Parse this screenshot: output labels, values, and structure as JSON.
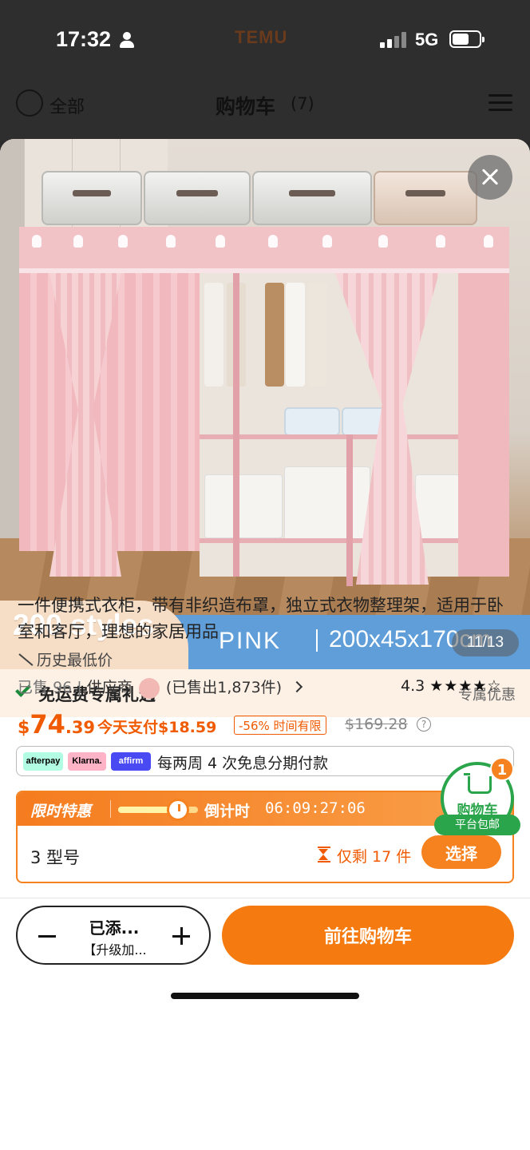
{
  "status_bar": {
    "time": "17:32",
    "brand": "TEMU",
    "network": "5G"
  },
  "cart_header": {
    "select_all": "全部",
    "title": "购物车",
    "count": "(7)"
  },
  "product": {
    "image_banner_styles": "200 styles",
    "image_banner_color": "PINK",
    "image_banner_size": "200x45x170cm",
    "image_counter": "11/13",
    "shipping_text": "免运费专属礼遇",
    "shipping_link": "专属优惠",
    "title": "一件便携式衣柜，带有非织造布罩，独立式衣物整理架，适用于卧室和客厅，理想的家居用品",
    "history_label": "历史最低价",
    "sold_label": "已售",
    "sold_count": "96",
    "supplier_label": "供应商",
    "supplier_sold": "(已售出1,873件)",
    "rating": "4.3",
    "stars": "★★★★☆",
    "price_currency": "$",
    "price_main": "74",
    "price_cents": ".39",
    "today_pay": "今天支付$18.59",
    "discount_badge": "-56% 时间有限",
    "old_price": "$169.28",
    "info_icon": "?"
  },
  "installment": {
    "afterpay": "afterpay",
    "klarna": "Klarna.",
    "affirm": "affirm",
    "text": "每两周 4 次免息分期付款"
  },
  "deal": {
    "title": "限时特惠",
    "progress": 0.75,
    "countdown_label": "倒计时",
    "countdown_value": "06:09:27:06",
    "variant_label": "3 型号",
    "stock_left": "仅剩 17 件",
    "choose_label": "选择"
  },
  "cart_float": {
    "label": "购物车",
    "ribbon": "平台包邮",
    "badge": "1"
  },
  "bottom_bar": {
    "qty_main": "已添...",
    "qty_sub": "【升级加...",
    "go_cart": "前往购物车"
  },
  "colors": {
    "accent": "#f57a10",
    "price": "#f05a00",
    "green": "#2aa54b"
  }
}
